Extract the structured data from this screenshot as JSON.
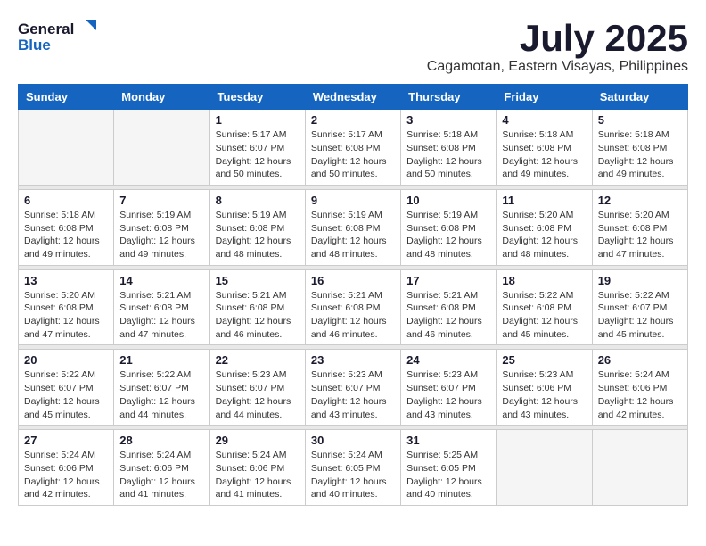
{
  "logo": {
    "general": "General",
    "blue": "Blue",
    "tagline": ""
  },
  "title": {
    "month_year": "July 2025",
    "location": "Cagamotan, Eastern Visayas, Philippines"
  },
  "headers": [
    "Sunday",
    "Monday",
    "Tuesday",
    "Wednesday",
    "Thursday",
    "Friday",
    "Saturday"
  ],
  "weeks": [
    [
      {
        "day": "",
        "info": ""
      },
      {
        "day": "",
        "info": ""
      },
      {
        "day": "1",
        "info": "Sunrise: 5:17 AM\nSunset: 6:07 PM\nDaylight: 12 hours and 50 minutes."
      },
      {
        "day": "2",
        "info": "Sunrise: 5:17 AM\nSunset: 6:08 PM\nDaylight: 12 hours and 50 minutes."
      },
      {
        "day": "3",
        "info": "Sunrise: 5:18 AM\nSunset: 6:08 PM\nDaylight: 12 hours and 50 minutes."
      },
      {
        "day": "4",
        "info": "Sunrise: 5:18 AM\nSunset: 6:08 PM\nDaylight: 12 hours and 49 minutes."
      },
      {
        "day": "5",
        "info": "Sunrise: 5:18 AM\nSunset: 6:08 PM\nDaylight: 12 hours and 49 minutes."
      }
    ],
    [
      {
        "day": "6",
        "info": "Sunrise: 5:18 AM\nSunset: 6:08 PM\nDaylight: 12 hours and 49 minutes."
      },
      {
        "day": "7",
        "info": "Sunrise: 5:19 AM\nSunset: 6:08 PM\nDaylight: 12 hours and 49 minutes."
      },
      {
        "day": "8",
        "info": "Sunrise: 5:19 AM\nSunset: 6:08 PM\nDaylight: 12 hours and 48 minutes."
      },
      {
        "day": "9",
        "info": "Sunrise: 5:19 AM\nSunset: 6:08 PM\nDaylight: 12 hours and 48 minutes."
      },
      {
        "day": "10",
        "info": "Sunrise: 5:19 AM\nSunset: 6:08 PM\nDaylight: 12 hours and 48 minutes."
      },
      {
        "day": "11",
        "info": "Sunrise: 5:20 AM\nSunset: 6:08 PM\nDaylight: 12 hours and 48 minutes."
      },
      {
        "day": "12",
        "info": "Sunrise: 5:20 AM\nSunset: 6:08 PM\nDaylight: 12 hours and 47 minutes."
      }
    ],
    [
      {
        "day": "13",
        "info": "Sunrise: 5:20 AM\nSunset: 6:08 PM\nDaylight: 12 hours and 47 minutes."
      },
      {
        "day": "14",
        "info": "Sunrise: 5:21 AM\nSunset: 6:08 PM\nDaylight: 12 hours and 47 minutes."
      },
      {
        "day": "15",
        "info": "Sunrise: 5:21 AM\nSunset: 6:08 PM\nDaylight: 12 hours and 46 minutes."
      },
      {
        "day": "16",
        "info": "Sunrise: 5:21 AM\nSunset: 6:08 PM\nDaylight: 12 hours and 46 minutes."
      },
      {
        "day": "17",
        "info": "Sunrise: 5:21 AM\nSunset: 6:08 PM\nDaylight: 12 hours and 46 minutes."
      },
      {
        "day": "18",
        "info": "Sunrise: 5:22 AM\nSunset: 6:08 PM\nDaylight: 12 hours and 45 minutes."
      },
      {
        "day": "19",
        "info": "Sunrise: 5:22 AM\nSunset: 6:07 PM\nDaylight: 12 hours and 45 minutes."
      }
    ],
    [
      {
        "day": "20",
        "info": "Sunrise: 5:22 AM\nSunset: 6:07 PM\nDaylight: 12 hours and 45 minutes."
      },
      {
        "day": "21",
        "info": "Sunrise: 5:22 AM\nSunset: 6:07 PM\nDaylight: 12 hours and 44 minutes."
      },
      {
        "day": "22",
        "info": "Sunrise: 5:23 AM\nSunset: 6:07 PM\nDaylight: 12 hours and 44 minutes."
      },
      {
        "day": "23",
        "info": "Sunrise: 5:23 AM\nSunset: 6:07 PM\nDaylight: 12 hours and 43 minutes."
      },
      {
        "day": "24",
        "info": "Sunrise: 5:23 AM\nSunset: 6:07 PM\nDaylight: 12 hours and 43 minutes."
      },
      {
        "day": "25",
        "info": "Sunrise: 5:23 AM\nSunset: 6:06 PM\nDaylight: 12 hours and 43 minutes."
      },
      {
        "day": "26",
        "info": "Sunrise: 5:24 AM\nSunset: 6:06 PM\nDaylight: 12 hours and 42 minutes."
      }
    ],
    [
      {
        "day": "27",
        "info": "Sunrise: 5:24 AM\nSunset: 6:06 PM\nDaylight: 12 hours and 42 minutes."
      },
      {
        "day": "28",
        "info": "Sunrise: 5:24 AM\nSunset: 6:06 PM\nDaylight: 12 hours and 41 minutes."
      },
      {
        "day": "29",
        "info": "Sunrise: 5:24 AM\nSunset: 6:06 PM\nDaylight: 12 hours and 41 minutes."
      },
      {
        "day": "30",
        "info": "Sunrise: 5:24 AM\nSunset: 6:05 PM\nDaylight: 12 hours and 40 minutes."
      },
      {
        "day": "31",
        "info": "Sunrise: 5:25 AM\nSunset: 6:05 PM\nDaylight: 12 hours and 40 minutes."
      },
      {
        "day": "",
        "info": ""
      },
      {
        "day": "",
        "info": ""
      }
    ]
  ]
}
